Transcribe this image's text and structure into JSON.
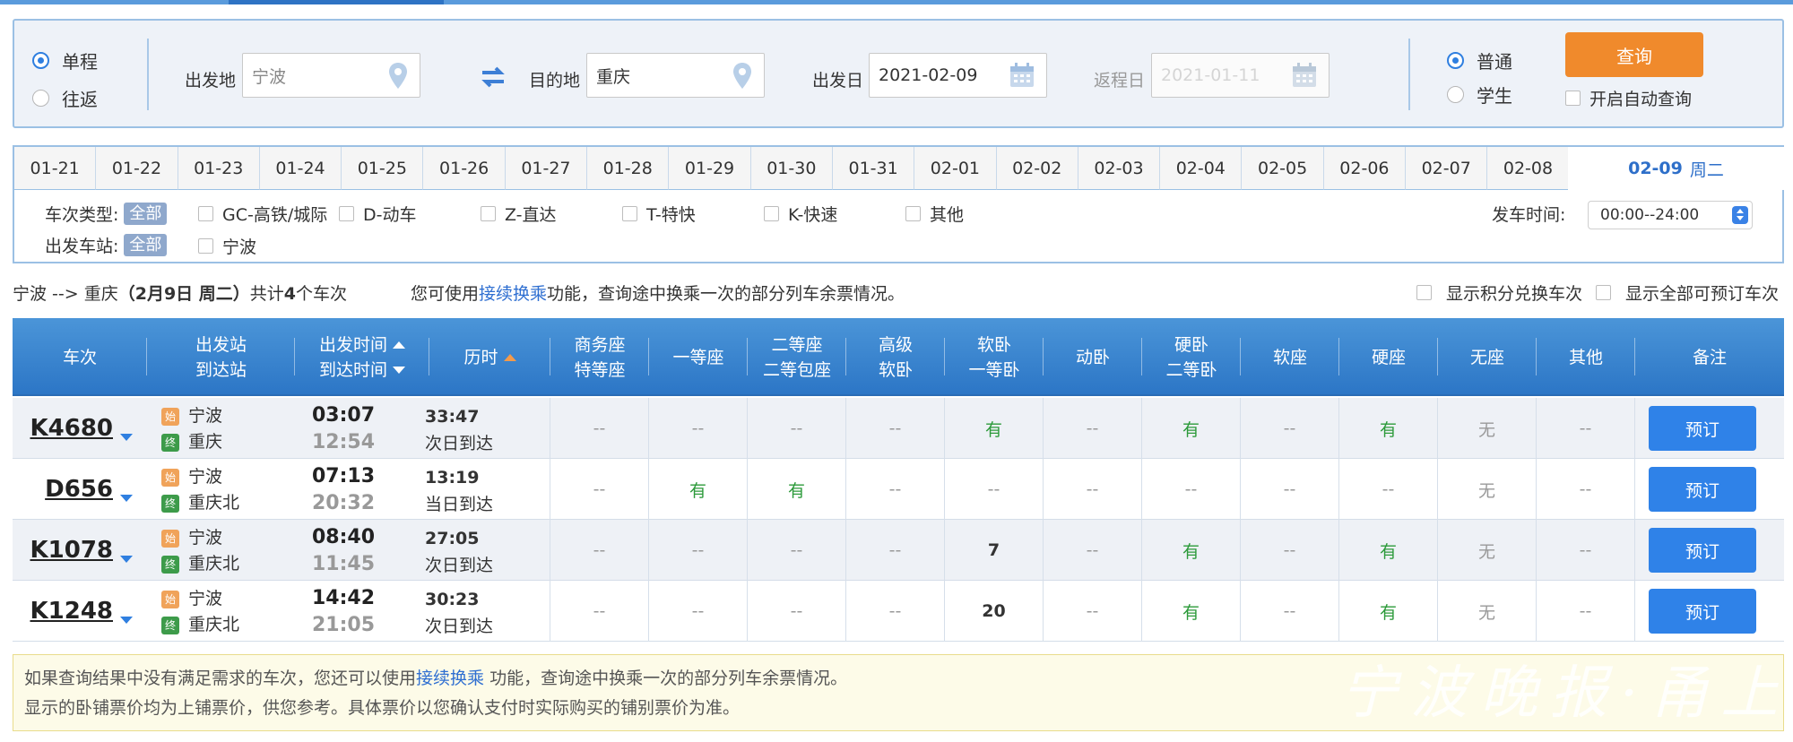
{
  "search": {
    "trip_types": [
      "单程",
      "往返"
    ],
    "trip_selected": "单程",
    "from_label": "出发地",
    "from_value": "宁波",
    "to_label": "目的地",
    "to_value": "重庆",
    "depart_label": "出发日",
    "depart_value": "2021-02-09",
    "return_label": "返程日",
    "return_value": "2021-01-11",
    "passenger_types": [
      "普通",
      "学生"
    ],
    "passenger_selected": "普通",
    "query_label": "查询",
    "auto_query_label": "开启自动查询"
  },
  "dates": [
    "01-21",
    "01-22",
    "01-23",
    "01-24",
    "01-25",
    "01-26",
    "01-27",
    "01-28",
    "01-29",
    "01-30",
    "01-31",
    "02-01",
    "02-02",
    "02-03",
    "02-04",
    "02-05",
    "02-06",
    "02-07",
    "02-08"
  ],
  "active_date": {
    "date": "02-09",
    "weekday": "周二"
  },
  "filters": {
    "type_label": "车次类型:",
    "all_label": "全部",
    "types": [
      "GC-高铁/城际",
      "D-动车",
      "Z-直达",
      "T-特快",
      "K-快速",
      "其他"
    ],
    "station_label": "出发车站:",
    "stations": [
      "宁波"
    ],
    "time_label": "发车时间:",
    "time_value": "00:00--24:00"
  },
  "summary": {
    "route": "宁波 --> 重庆",
    "date_text": "（2月9日 周二）",
    "count_prefix": "共计",
    "count": "4",
    "count_suffix": "个车次",
    "tip_pre": "您可使用",
    "tip_link": "接续换乘",
    "tip_post": "功能，查询途中换乘一次的部分列车余票情况。",
    "opt_points": "显示积分兑换车次",
    "opt_all": "显示全部可预订车次"
  },
  "columns": {
    "train": "车次",
    "station1": "出发站",
    "station2": "到达站",
    "time1": "出发时间",
    "time2": "到达时间",
    "duration": "历时",
    "business1": "商务座",
    "business2": "特等座",
    "first": "一等座",
    "second1": "二等座",
    "second2": "二等包座",
    "hsoft1": "高级",
    "hsoft2": "软卧",
    "soft1": "软卧",
    "soft2": "一等卧",
    "dw": "动卧",
    "hard1": "硬卧",
    "hard2": "二等卧",
    "softseat": "软座",
    "hardseat": "硬座",
    "noseat": "无座",
    "other": "其他",
    "remark": "备注"
  },
  "trains": [
    {
      "no": "K4680",
      "from": "宁波",
      "to": "重庆",
      "dep": "03:07",
      "arr": "12:54",
      "dur": "33:47",
      "arrive_day": "次日到达",
      "seats": [
        "--",
        "--",
        "--",
        "--",
        "有",
        "--",
        "有",
        "--",
        "有",
        "无",
        "--"
      ],
      "book": "预订"
    },
    {
      "no": "D656",
      "from": "宁波",
      "to": "重庆北",
      "dep": "07:13",
      "arr": "20:32",
      "dur": "13:19",
      "arrive_day": "当日到达",
      "seats": [
        "--",
        "有",
        "有",
        "--",
        "--",
        "--",
        "--",
        "--",
        "--",
        "无",
        "--"
      ],
      "book": "预订"
    },
    {
      "no": "K1078",
      "from": "宁波",
      "to": "重庆北",
      "dep": "08:40",
      "arr": "11:45",
      "dur": "27:05",
      "arrive_day": "次日到达",
      "seats": [
        "--",
        "--",
        "--",
        "--",
        "7",
        "--",
        "有",
        "--",
        "有",
        "无",
        "--"
      ],
      "book": "预订"
    },
    {
      "no": "K1248",
      "from": "宁波",
      "to": "重庆北",
      "dep": "14:42",
      "arr": "21:05",
      "dur": "30:23",
      "arrive_day": "次日到达",
      "seats": [
        "--",
        "--",
        "--",
        "--",
        "20",
        "--",
        "有",
        "--",
        "有",
        "无",
        "--"
      ],
      "book": "预订"
    }
  ],
  "badges": {
    "start": "始",
    "end": "终"
  },
  "notice": {
    "line1_pre": "如果查询结果中没有满足需求的车次，您还可以使用",
    "line1_link": "接续换乘",
    "line1_post": " 功能，查询途中换乘一次的部分列车余票情况。",
    "line2": "显示的卧铺票价均为上铺票价，供您参考。具体票价以您确认支付时实际购买的铺别票价为准。"
  },
  "watermark": "宁波晚报·甬上",
  "colors": {
    "accent": "#2f82e8",
    "query": "#f08a2c",
    "available": "#2c9a3a",
    "header": "#2c76c6"
  }
}
